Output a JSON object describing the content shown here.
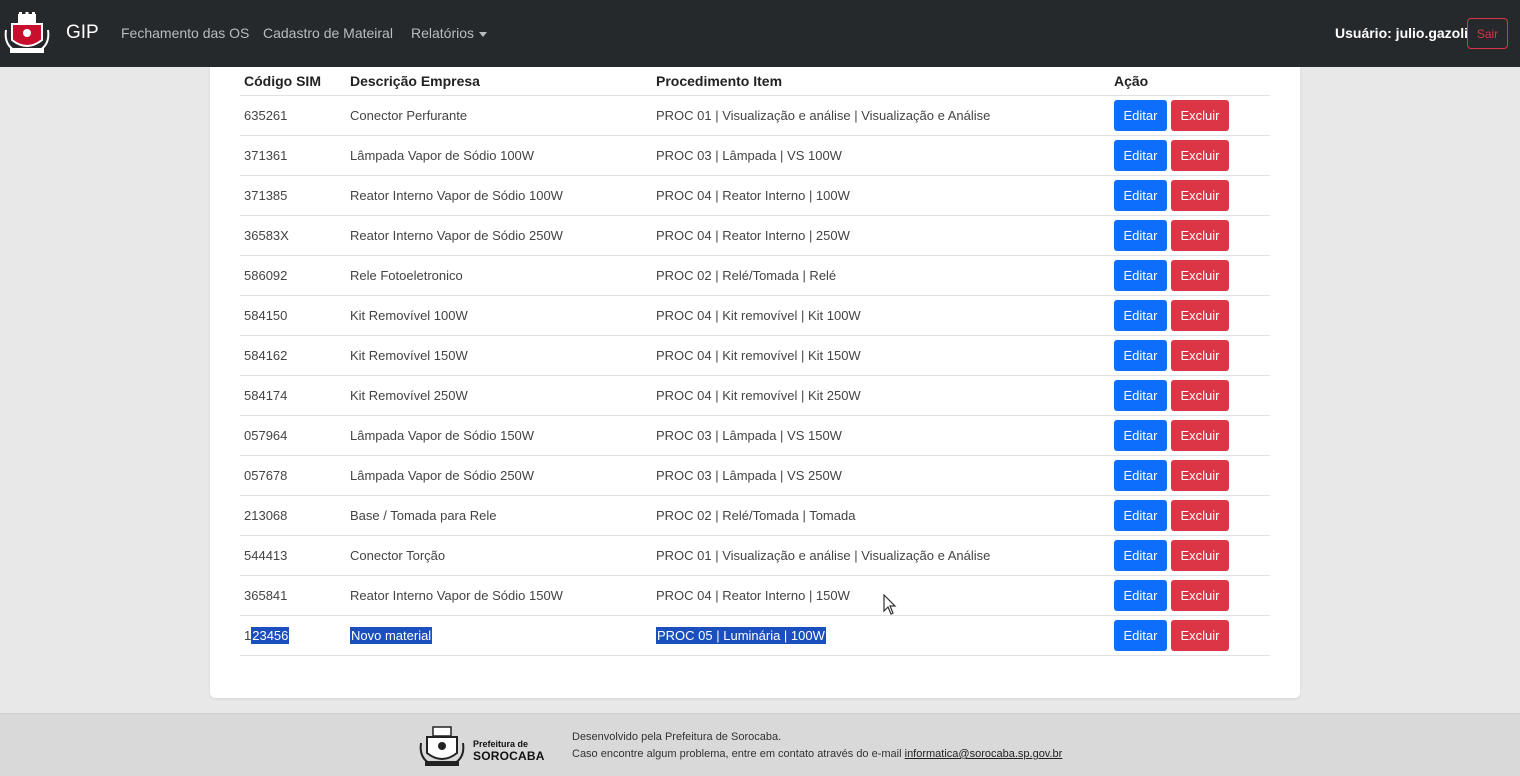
{
  "navbar": {
    "brand": "GIP",
    "links": [
      "Fechamento das OS",
      "Cadastro de Mateiral",
      "Relatórios"
    ],
    "user_label": "Usuário: julio.gazoli",
    "logout_label": "Sair"
  },
  "table": {
    "headers": [
      "Código SIM",
      "Descrição Empresa",
      "Procedimento Item",
      "Ação"
    ],
    "edit_label": "Editar",
    "delete_label": "Excluir",
    "rows": [
      {
        "code": "635261",
        "description": "Conector Perfurante",
        "procedure": "PROC 01 | Visualização e análise | Visualização e Análise"
      },
      {
        "code": "371361",
        "description": "Lâmpada Vapor de Sódio 100W",
        "procedure": "PROC 03 | Lâmpada | VS 100W"
      },
      {
        "code": "371385",
        "description": "Reator Interno Vapor de Sódio 100W",
        "procedure": "PROC 04 | Reator Interno | 100W"
      },
      {
        "code": "36583X",
        "description": "Reator Interno Vapor de Sódio 250W",
        "procedure": "PROC 04 | Reator Interno | 250W"
      },
      {
        "code": "586092",
        "description": "Rele Fotoeletronico",
        "procedure": "PROC 02 | Relé/Tomada | Relé"
      },
      {
        "code": "584150",
        "description": "Kit Removível 100W",
        "procedure": "PROC 04 | Kit removível | Kit 100W"
      },
      {
        "code": "584162",
        "description": "Kit Removível 150W",
        "procedure": "PROC 04 | Kit removível | Kit 150W"
      },
      {
        "code": "584174",
        "description": "Kit Removível 250W",
        "procedure": "PROC 04 | Kit removível | Kit 250W"
      },
      {
        "code": "057964",
        "description": "Lâmpada Vapor de Sódio 150W",
        "procedure": "PROC 03 | Lâmpada | VS 150W"
      },
      {
        "code": "057678",
        "description": "Lâmpada Vapor de Sódio 250W",
        "procedure": "PROC 03 | Lâmpada | VS 250W"
      },
      {
        "code": "213068",
        "description": "Base / Tomada para Rele",
        "procedure": "PROC 02 | Relé/Tomada | Tomada"
      },
      {
        "code": "544413",
        "description": "Conector Torção",
        "procedure": "PROC 01 | Visualização e análise | Visualização e Análise"
      },
      {
        "code": "365841",
        "description": "Reator Interno Vapor de Sódio 150W",
        "procedure": "PROC 04 | Reator Interno | 150W"
      }
    ],
    "last_row": {
      "code_prefix": "1",
      "code_selected": "23456",
      "description": "Novo material",
      "procedure": "PROC 05 | Luminária | 100W"
    }
  },
  "footer": {
    "brand_small": "Prefeitura de",
    "brand_big": "SOROCABA",
    "line1": "Desenvolvido pela Prefeitura de Sorocaba.",
    "line2": "Caso encontre algum problema, entre em contato através do e-mail ",
    "email": "informatica@sorocaba.sp.gov.br"
  },
  "colors": {
    "navbar_bg": "#26292c",
    "edit": "#0d6efd",
    "delete": "#dc3545",
    "selection": "#1a4fbd"
  }
}
